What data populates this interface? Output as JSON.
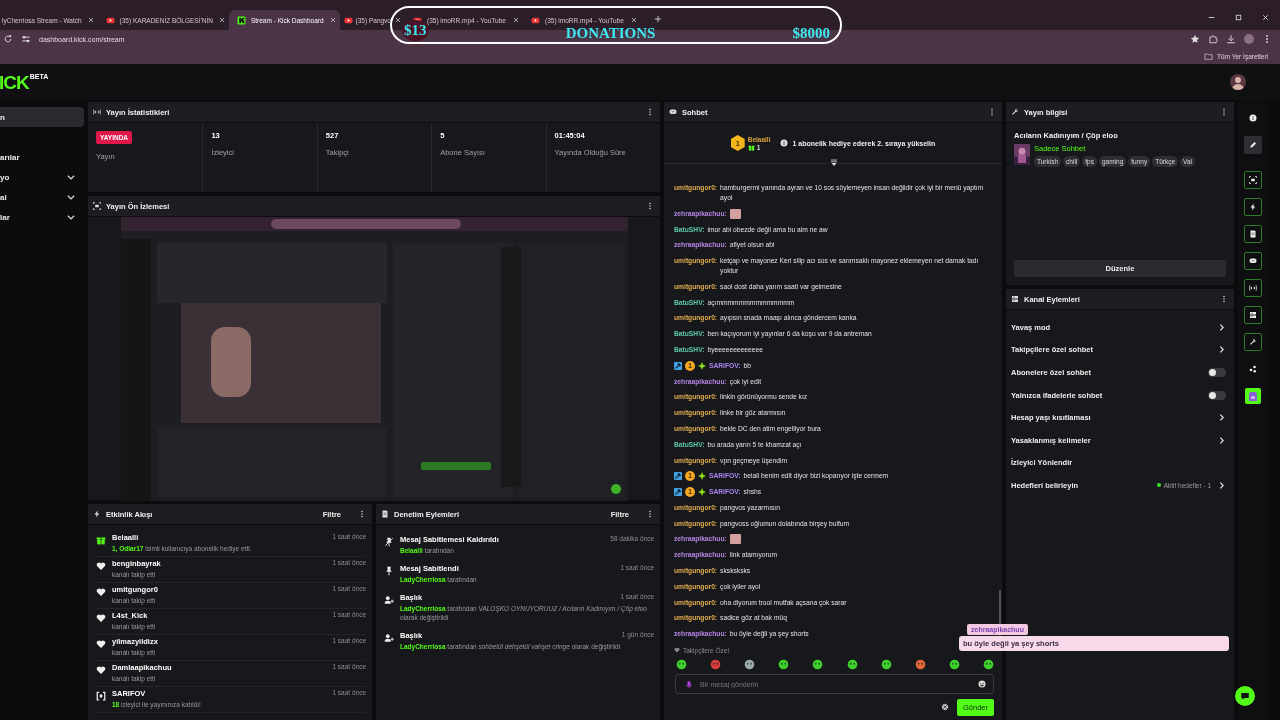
{
  "browser": {
    "tabs": [
      {
        "title": "lyCherriosa Stream - Watch",
        "selected": false
      },
      {
        "title": "(35) KARADENİZ BÖLGESİ'NİN",
        "kind": "youtube",
        "selected": false
      },
      {
        "title": "Stream - Kick Dashboard",
        "kind": "kick",
        "selected": true
      },
      {
        "title": "(35) Pangvo",
        "kind": "youtube",
        "selected": false
      },
      {
        "title": "(35) imoRR.mp4 - YouTube",
        "kind": "youtube",
        "selected": false
      },
      {
        "title": "(35) imoRR.mp4 - YouTube",
        "kind": "youtube",
        "selected": false
      }
    ],
    "url": "dashboard.kick.com/stream",
    "bookmarks_folder": "Tüm Yer İşaretleri"
  },
  "donation_overlay": {
    "left": "$13",
    "title": "DONATIONS",
    "right": "$8000"
  },
  "header": {
    "logo": "ICK",
    "logo_badge": "BETA"
  },
  "sidebar": {
    "items": [
      {
        "label": "n",
        "kind": "link",
        "selected": true
      },
      {
        "label": "arılar",
        "kind": "link",
        "selected": false
      },
      {
        "label": "yo",
        "kind": "group",
        "selected": false
      },
      {
        "label": "al",
        "kind": "group",
        "selected": false
      },
      {
        "label": "lar",
        "kind": "group",
        "selected": false
      }
    ]
  },
  "stats": {
    "title": "Yayın İstatistikleri",
    "live_badge": "YAYINDA",
    "live_label": "Yayın",
    "items": [
      {
        "value": "13",
        "label": "İzleyici"
      },
      {
        "value": "527",
        "label": "Takipçi"
      },
      {
        "value": "5",
        "label": "Abone Sayısı"
      },
      {
        "value": "01:45:04",
        "label": "Yayında Olduğu Süre"
      }
    ]
  },
  "preview": {
    "title": "Yayın Ön İzlemesi",
    "kind": "picture"
  },
  "events": {
    "title": "Etkinlik Akışı",
    "filter": "Filtre",
    "items": [
      {
        "kind": "gift",
        "user": "Belaalli",
        "time": "1 saat önce",
        "detail": "**1, Odlar17** isimli kullanıcıya abonelik hediye etti."
      },
      {
        "kind": "follow",
        "user": "benginbayrak",
        "time": "1 saat önce",
        "detail": "kanalı takip etti"
      },
      {
        "kind": "follow",
        "user": "umitgungor0",
        "time": "1 saat önce",
        "detail": "kanalı takip etti"
      },
      {
        "kind": "follow",
        "user": "L4st_Kick",
        "time": "1 saat önce",
        "detail": "kanalı takip etti"
      },
      {
        "kind": "follow",
        "user": "yilmazyildizx",
        "time": "1 saat önce",
        "detail": "kanalı takip etti"
      },
      {
        "kind": "follow",
        "user": "Damlaapikachuu",
        "time": "1 saat önce",
        "detail": "kanalı takip etti"
      },
      {
        "kind": "raid",
        "user": "SARIFOV",
        "time": "1 saat önce",
        "detail": "**18** izleyici ile yayınınıza katıldı!"
      }
    ]
  },
  "moderation": {
    "title": "Denetim Eylemleri",
    "filter": "Filtre",
    "items": [
      {
        "kind": "unpin",
        "action": "Mesaj Sabitlemesi Kaldırıldı",
        "time": "58 dakika önce",
        "detail": "**Belaalli** tarafından"
      },
      {
        "kind": "pin",
        "action": "Mesaj Sabitlendi",
        "time": "1 saat önce",
        "detail": "**LadyCherriosa** tarafından"
      },
      {
        "kind": "title",
        "action": "Başlık",
        "time": "1 saat önce",
        "detail": "**LadyCherriosa** tarafından *VALOŞKO OYNUYORUUZ / Acıların Kadınıyım / Çöp eloo* olarak değiştirildi"
      },
      {
        "kind": "title",
        "action": "Başlık",
        "time": "1 gün önce",
        "detail": "**LadyCherriosa** tarafından *sohbetül dehşetül vahşet cringe* olarak değiştirildi"
      }
    ]
  },
  "chat": {
    "title": "Sohbet",
    "leader": {
      "rank": "1",
      "name": "Belaalli",
      "count": "1",
      "prompt": "1 abonelik hediye ederek 2. sıraya yükselin"
    },
    "messages": [
      {
        "kind": "text",
        "user": "umitgungor0:",
        "color": "#e3ad4e",
        "text": "hamburgermi yanında ayran ve 10 sos söylemeyen insan değildir çok iyi bir menü yaptım ayol"
      },
      {
        "kind": "emote",
        "user": "zehraapikachuu:",
        "color": "#b784e8"
      },
      {
        "kind": "text",
        "user": "BatuSHV:",
        "color": "#5fcaa5",
        "text": "imor abi obezde değil ama bu aim ne aw"
      },
      {
        "kind": "text",
        "user": "zehraapikachuu:",
        "color": "#b784e8",
        "text": "afiyet olsun abi"
      },
      {
        "kind": "text",
        "user": "umitgungor0:",
        "color": "#e3ad4e",
        "text": "ketçap ve mayonez Keri silip acı sos ve sarımsaklı mayonez eklemeyen net damak tadı yoktur"
      },
      {
        "kind": "text",
        "user": "umitgungor0:",
        "color": "#e3ad4e",
        "text": "saol dost daha yarım saati var gelmesine"
      },
      {
        "kind": "text",
        "user": "BatuSHV:",
        "color": "#5fcaa5",
        "text": "açımmmmmmmmmmmmmm"
      },
      {
        "kind": "text",
        "user": "umitgungor0:",
        "color": "#e3ad4e",
        "text": "ayıpsın snada maaşı alınca göndercem kanka"
      },
      {
        "kind": "text",
        "user": "BatuSHV:",
        "color": "#5fcaa5",
        "text": "ben kaçıyorum iyi yayınlar 6 da koşu var 9 da antreman"
      },
      {
        "kind": "text",
        "user": "BatuSHV:",
        "color": "#5fcaa5",
        "text": "byeeeeeeeeeeeee"
      },
      {
        "kind": "text",
        "user": "SARIFOV:",
        "color": "#a986f2",
        "badges": [
          {
            "kind": "moderator"
          },
          {
            "kind": "subscriber",
            "text": "1"
          },
          {
            "kind": "verified"
          }
        ],
        "text": "bb"
      },
      {
        "kind": "text",
        "user": "zehraapikachuu:",
        "color": "#b784e8",
        "text": "çok iyi edit"
      },
      {
        "kind": "text",
        "user": "umitgungor0:",
        "color": "#e3ad4e",
        "text": "linkin görünüyormu sende kız"
      },
      {
        "kind": "text",
        "user": "umitgungor0:",
        "color": "#e3ad4e",
        "text": "linke bir göz atarmısın"
      },
      {
        "kind": "text",
        "user": "umitgungor0:",
        "color": "#e3ad4e",
        "text": "bekle DC den atim engelliyor bura"
      },
      {
        "kind": "text",
        "user": "BatuSHV:",
        "color": "#5fcaa5",
        "text": "bu arada yarın 5 te khamzat açı"
      },
      {
        "kind": "text",
        "user": "umitgungor0:",
        "color": "#e3ad4e",
        "text": "vpn geçmeye üşendim"
      },
      {
        "kind": "text",
        "user": "SARIFOV:",
        "color": "#a986f2",
        "badges": [
          {
            "kind": "moderator"
          },
          {
            "kind": "subscriber",
            "text": "1"
          },
          {
            "kind": "verified"
          }
        ],
        "text": "belali benim edit diyor bizi koparıyor işte cermem"
      },
      {
        "kind": "text",
        "user": "SARIFOV:",
        "color": "#a986f2",
        "badges": [
          {
            "kind": "moderator"
          },
          {
            "kind": "subscriber",
            "text": "1"
          },
          {
            "kind": "verified"
          }
        ],
        "text": "shshs"
      },
      {
        "kind": "text",
        "user": "umitgungor0:",
        "color": "#e3ad4e",
        "text": "pangvos yazarmısın"
      },
      {
        "kind": "text",
        "user": "umitgungor0:",
        "color": "#e3ad4e",
        "text": "pangvoss oğlumun dolabında birşey bulfum"
      },
      {
        "kind": "emote",
        "user": "zehraapikachuu:",
        "color": "#b784e8"
      },
      {
        "kind": "text",
        "user": "zehraapikachuu:",
        "color": "#b784e8",
        "text": "link atamıyorum"
      },
      {
        "kind": "text",
        "user": "umitgungor0:",
        "color": "#e3ad4e",
        "text": "sksksksks"
      },
      {
        "kind": "text",
        "user": "umitgungor0:",
        "color": "#e3ad4e",
        "text": "çok iyiler ayol"
      },
      {
        "kind": "text",
        "user": "umitgungor0:",
        "color": "#e3ad4e",
        "text": "oha diyorum trool mutfak açsana çok sarar"
      },
      {
        "kind": "text",
        "user": "umitgungor0:",
        "color": "#e3ad4e",
        "text": "sadice göz at bak müq"
      },
      {
        "kind": "text",
        "user": "zehraapikachuu:",
        "color": "#b784e8",
        "text": "bu öyle değil ya şey shorts"
      }
    ],
    "follower_mode": "Takipçilere Özel",
    "input": {
      "placeholder": "Bir mesaj gönderin"
    },
    "send": "Gönder"
  },
  "stream_info": {
    "title": "Yayın bilgisi",
    "stream_title": "Acıların Kadınıyım / Çöp eloo",
    "category": "Sadece Sohbet",
    "tags": [
      "Turkish",
      "chill",
      "fps",
      "gaming",
      "funny",
      "Türkçe",
      "Val"
    ],
    "edit": "Düzenle"
  },
  "channel_actions": {
    "title": "Kanal Eylemleri",
    "items": [
      {
        "kind": "link",
        "label": "Yavaş mod"
      },
      {
        "kind": "link",
        "label": "Takipçilere özel sohbet"
      },
      {
        "kind": "toggle",
        "label": "Abonelere özel sohbet",
        "on": false
      },
      {
        "kind": "toggle",
        "label": "Yalnızca ifadelerle sohbet",
        "on": false
      },
      {
        "kind": "link",
        "label": "Hesap yaşı kısıtlaması"
      },
      {
        "kind": "link",
        "label": "Yasaklanmış kelimeler"
      },
      {
        "kind": "plain",
        "label": "İzleyici Yönlendir"
      },
      {
        "kind": "link",
        "label": "Hedefleri belirleyin",
        "status": "Aktif hedefler - 1"
      }
    ]
  },
  "rail": [
    {
      "kind": "info",
      "active": false
    },
    {
      "kind": "pencil",
      "active": false
    },
    {
      "kind": "preview",
      "active": true
    },
    {
      "kind": "bolt",
      "active": true
    },
    {
      "kind": "doc",
      "active": true
    },
    {
      "kind": "chat",
      "active": true
    },
    {
      "kind": "stats",
      "active": true
    },
    {
      "kind": "server",
      "active": true
    },
    {
      "kind": "wrench",
      "active": true
    },
    {
      "kind": "nodes",
      "active": false
    },
    {
      "kind": "app",
      "active": false
    }
  ],
  "chat_popup": {
    "user": "zehraapikachuu",
    "text": "bu öyle değil ya şey shorts"
  }
}
